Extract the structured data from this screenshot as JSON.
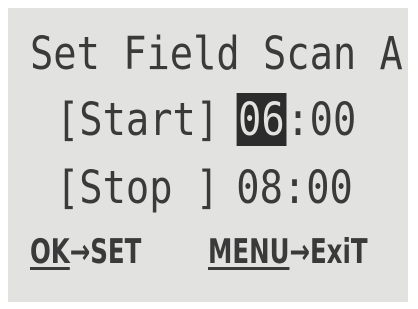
{
  "screen": {
    "title": "Set Field Scan A",
    "start": {
      "label": "[Start]",
      "hour": "06",
      "separator": ":",
      "minute": "00"
    },
    "stop": {
      "label": "[Stop ]",
      "hour": "08",
      "separator": ":",
      "minute": "00"
    },
    "footer": {
      "ok_key": "OK",
      "ok_action": "→SET",
      "menu_key": "MENU",
      "menu_action": "→ExiT"
    },
    "colors": {
      "background": "#e2e2e0",
      "text": "#3a3a3a",
      "highlight": "#2c2c2c"
    }
  }
}
